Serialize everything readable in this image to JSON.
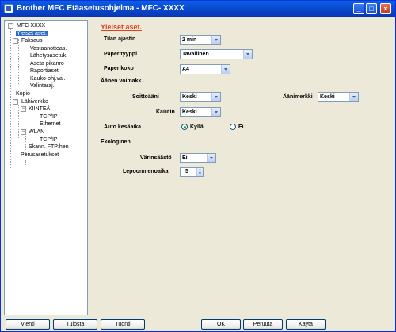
{
  "window": {
    "title": "Brother MFC Etäasetusohjelma - MFC- XXXX"
  },
  "tree": {
    "items": [
      {
        "label": "MFC-XXXX"
      },
      {
        "label": "Yleiset aset."
      },
      {
        "label": "Faksaus"
      },
      {
        "label": "Vastaanottoas."
      },
      {
        "label": "Lähetysasetuk."
      },
      {
        "label": "Aseta pikanro"
      },
      {
        "label": "Raportiaset."
      },
      {
        "label": "Kauko-ohj.val."
      },
      {
        "label": "Valintaraj."
      },
      {
        "label": "Kopio"
      },
      {
        "label": "Lähiverkko"
      },
      {
        "label": "KIINTEÄ"
      },
      {
        "label": "TCP/IP"
      },
      {
        "label": "Ethernet"
      },
      {
        "label": "WLAN"
      },
      {
        "label": "TCP/IP"
      },
      {
        "label": "Skann. FTP:hen"
      },
      {
        "label": "Perusasetukset"
      }
    ]
  },
  "panel": {
    "title": "Yleiset aset.",
    "mode_timer": {
      "label": "Tilan ajastin",
      "value": "2 min"
    },
    "paper_type": {
      "label": "Paperityyppi",
      "value": "Tavallinen"
    },
    "paper_size": {
      "label": "Paperikoko",
      "value": "A4"
    },
    "volume": {
      "heading": "Äänen voimakk.",
      "ring": {
        "label": "Soittoääni",
        "value": "Keski"
      },
      "beeper": {
        "label": "Äänimerkki",
        "value": "Keski"
      },
      "speaker": {
        "label": "Kaiutin",
        "value": "Keski"
      }
    },
    "dst": {
      "label": "Auto kesäaika",
      "yes": "Kyllä",
      "no": "Ei",
      "selected": "Kyllä"
    },
    "ecology": {
      "heading": "Ekologinen",
      "toner_save": {
        "label": "Värinsäästö",
        "value": "Ei"
      },
      "sleep_time": {
        "label": "Lepoonmenoaika",
        "value": "5"
      }
    }
  },
  "buttons": {
    "export": "Vienti",
    "print": "Tulosta",
    "import": "Tuonti",
    "ok": "OK",
    "cancel": "Peruuta",
    "apply": "Käytä"
  }
}
